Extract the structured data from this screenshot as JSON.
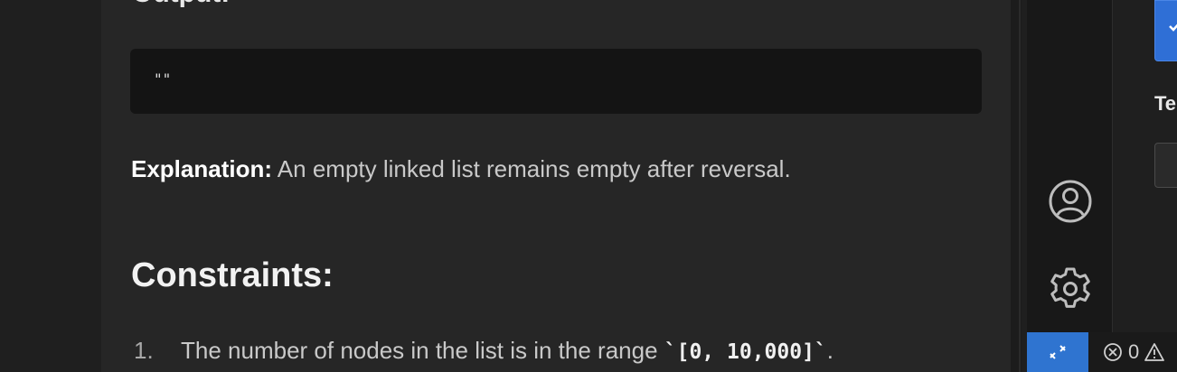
{
  "doc": {
    "prev_heading": "Output:",
    "code_output": "\"\"",
    "explanation_label": "Explanation:",
    "explanation_text": " An empty linked list remains empty after reversal.",
    "constraints_heading": "Constraints:",
    "constraints": [
      {
        "number": "1.",
        "text_before": "The number of nodes in the list is in the range ",
        "code": "`[0, 10,000]`",
        "text_after": "."
      }
    ]
  },
  "activity_bar": {
    "icons": [
      "account-icon",
      "gear-icon"
    ]
  },
  "right_panel": {
    "label": "Te"
  },
  "status_bar": {
    "errors_count": "0",
    "icons": [
      "remote-icon",
      "error-icon",
      "warning-icon"
    ]
  },
  "colors": {
    "accent": "#2f74d0",
    "content_bg": "#262626",
    "code_bg": "#141414"
  }
}
